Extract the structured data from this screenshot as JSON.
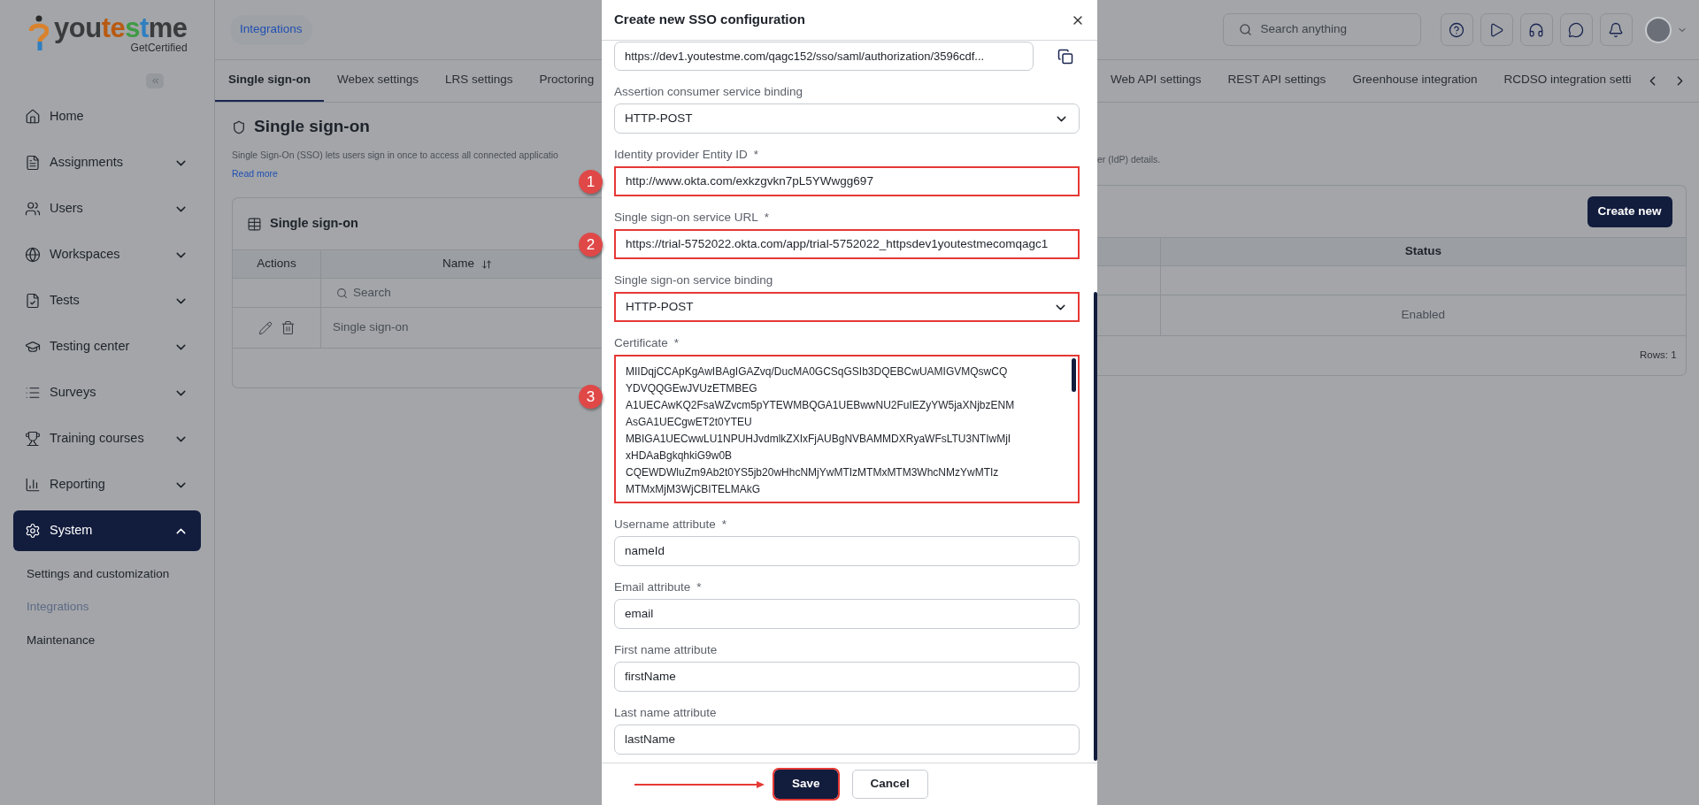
{
  "sidebar": {
    "logo": {
      "parts": [
        {
          "text": "you",
          "color": "#3a3b3d"
        },
        {
          "text": "te",
          "color": "#b85a12"
        },
        {
          "text": "s",
          "color": "#3f9a45"
        },
        {
          "text": "t",
          "color": "#2f7fc1"
        },
        {
          "text": "me",
          "color": "#3a3b3d"
        }
      ],
      "tagline": "GetCertified"
    },
    "items": [
      {
        "label": "Home",
        "selected": false
      },
      {
        "label": "Assignments",
        "expanded": false,
        "selected": false
      },
      {
        "label": "Users",
        "expanded": false,
        "selected": false
      },
      {
        "label": "Workspaces",
        "expanded": false,
        "selected": false
      },
      {
        "label": "Tests",
        "expanded": false,
        "selected": false
      },
      {
        "label": "Testing center",
        "expanded": false,
        "selected": false
      },
      {
        "label": "Surveys",
        "expanded": false,
        "selected": false
      },
      {
        "label": "Training courses",
        "expanded": false,
        "selected": false
      },
      {
        "label": "Reporting",
        "expanded": false,
        "selected": false
      },
      {
        "label": "System",
        "expanded": true,
        "selected": true
      }
    ],
    "subitems": [
      {
        "label": "Settings and customization",
        "selected": false
      },
      {
        "label": "Integrations",
        "selected": true
      },
      {
        "label": "Maintenance",
        "selected": false
      }
    ]
  },
  "topbar": {
    "breadcrumb": "Integrations",
    "search": {
      "placeholder": "Search anything"
    }
  },
  "tabs_left": [
    {
      "label": "Single sign-on",
      "selected": true
    },
    {
      "label": "Webex settings",
      "selected": false
    },
    {
      "label": "LRS settings",
      "selected": false
    },
    {
      "label": "Proctoring",
      "selected": false
    }
  ],
  "tabs_right": [
    {
      "label": "Web API settings",
      "selected": false
    },
    {
      "label": "REST API settings",
      "selected": false
    },
    {
      "label": "Greenhouse integration",
      "selected": false
    },
    {
      "label": "RCDSO integration setti",
      "selected": false
    }
  ],
  "page": {
    "title": "Single sign-on",
    "description_left": "Single Sign-On (SSO) lets users sign in once to access all connected applicatio",
    "description_right": "er (IdP) details.",
    "read_more": "Read more"
  },
  "card": {
    "title": "Single sign-on",
    "create_button": "Create new",
    "columns": [
      "Actions",
      "Name",
      "Status"
    ],
    "search_placeholder": "Search",
    "rows": [
      {
        "name": "Single sign-on",
        "status": "Enabled"
      }
    ],
    "footer": "Rows: 1"
  },
  "modal": {
    "title": "Create new SSO configuration",
    "acs_url": "https://dev1.youtestme.com/qagc152/sso/saml/authorization/3596cdf...",
    "fields": [
      {
        "kind": "select",
        "label": "Assertion consumer service binding",
        "value": "HTTP-POST",
        "highlighted": false
      },
      {
        "kind": "input",
        "label": "Identity provider Entity ID",
        "required_mark": "*",
        "value": "http://www.okta.com/exkzgvkn7pL5YWwgg697",
        "highlighted": true,
        "marker": "1"
      },
      {
        "kind": "input",
        "label": "Single sign-on service URL",
        "required_mark": "*",
        "value": "https://trial-5752022.okta.com/app/trial-5752022_httpsdev1youtestmecomqagc1",
        "highlighted": true,
        "marker": "2"
      },
      {
        "kind": "select",
        "label": "Single sign-on service binding",
        "value": "HTTP-POST",
        "highlighted": true
      },
      {
        "kind": "textarea",
        "label": "Certificate",
        "required_mark": "*",
        "highlighted": true,
        "marker": "3",
        "lines": [
          "MIIDqjCCApKgAwIBAgIGAZvq/DucMA0GCSqGSIb3DQEBCwUAMIGVMQswCQ",
          "YDVQQGEwJVUzETMBEG",
          "A1UECAwKQ2FsaWZvcm5pYTEWMBQGA1UEBwwNU2FuIEZyYW5jaXNjbzENM",
          "AsGA1UECgwET2t0YTEU",
          "MBIGA1UECwwLU1NPUHJvdmlkZXIxFjAUBgNVBAMMDXRyaWFsLTU3NTIwMjI",
          "xHDAaBgkqhkiG9w0B",
          "CQEWDWluZm9Ab2t0YS5jb20wHhcNMjYwMTIzMTMxMTM3WhcNMzYwMTIz",
          "MTMxMjM3WjCBITELMAkG"
        ]
      },
      {
        "kind": "input",
        "label": "Username attribute",
        "required_mark": "*",
        "value": "nameId",
        "highlighted": false
      },
      {
        "kind": "input",
        "label": "Email attribute",
        "required_mark": "*",
        "value": "email",
        "highlighted": false
      },
      {
        "kind": "input",
        "label": "First name attribute",
        "value": "firstName",
        "highlighted": false
      },
      {
        "kind": "input",
        "label": "Last name attribute",
        "value": "lastName",
        "highlighted": false
      }
    ],
    "buttons": [
      {
        "label": "Save",
        "primary": true,
        "highlighted": true
      },
      {
        "label": "Cancel",
        "primary": false,
        "highlighted": false
      }
    ]
  }
}
